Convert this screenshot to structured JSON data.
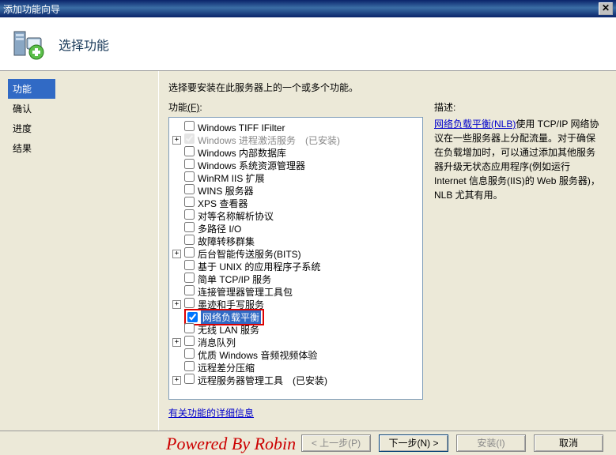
{
  "window": {
    "title": "添加功能向导"
  },
  "header": {
    "title": "选择功能"
  },
  "sidebar": {
    "items": [
      {
        "label": "功能",
        "active": true
      },
      {
        "label": "确认",
        "active": false
      },
      {
        "label": "进度",
        "active": false
      },
      {
        "label": "结果",
        "active": false
      }
    ]
  },
  "content": {
    "instruction": "选择要安装在此服务器上的一个或多个功能。",
    "feature_label_prefix": "功能",
    "feature_label_key": "(F)",
    "feature_label_suffix": ":",
    "more_link": "有关功能的详细信息"
  },
  "tree": [
    {
      "label": "Windows TIFF IFilter",
      "expand": "",
      "checked": false,
      "disabled": false
    },
    {
      "label": "Windows 进程激活服务　(已安装)",
      "expand": "+",
      "checked": true,
      "disabled": true
    },
    {
      "label": "Windows 内部数据库",
      "expand": "",
      "checked": false,
      "disabled": false
    },
    {
      "label": "Windows 系统资源管理器",
      "expand": "",
      "checked": false,
      "disabled": false
    },
    {
      "label": "WinRM IIS 扩展",
      "expand": "",
      "checked": false,
      "disabled": false
    },
    {
      "label": "WINS 服务器",
      "expand": "",
      "checked": false,
      "disabled": false
    },
    {
      "label": "XPS 查看器",
      "expand": "",
      "checked": false,
      "disabled": false
    },
    {
      "label": "对等名称解析协议",
      "expand": "",
      "checked": false,
      "disabled": false
    },
    {
      "label": "多路径 I/O",
      "expand": "",
      "checked": false,
      "disabled": false
    },
    {
      "label": "故障转移群集",
      "expand": "",
      "checked": false,
      "disabled": false
    },
    {
      "label": "后台智能传送服务(BITS)",
      "expand": "+",
      "checked": false,
      "disabled": false
    },
    {
      "label": "基于 UNIX 的应用程序子系统",
      "expand": "",
      "checked": false,
      "disabled": false
    },
    {
      "label": "简单 TCP/IP 服务",
      "expand": "",
      "checked": false,
      "disabled": false
    },
    {
      "label": "连接管理器管理工具包",
      "expand": "",
      "checked": false,
      "disabled": false
    },
    {
      "label": "墨迹和手写服务",
      "expand": "+",
      "checked": false,
      "disabled": false
    },
    {
      "label": "网络负载平衡",
      "expand": "",
      "checked": true,
      "disabled": false,
      "highlight": true
    },
    {
      "label": "无线 LAN 服务",
      "expand": "",
      "checked": false,
      "disabled": false
    },
    {
      "label": "消息队列",
      "expand": "+",
      "checked": false,
      "disabled": false
    },
    {
      "label": "优质 Windows 音频视频体验",
      "expand": "",
      "checked": false,
      "disabled": false
    },
    {
      "label": "远程差分压缩",
      "expand": "",
      "checked": false,
      "disabled": false
    },
    {
      "label": "远程服务器管理工具　(已安装)",
      "expand": "+",
      "checked": false,
      "disabled": false
    }
  ],
  "description": {
    "title": "描述:",
    "link_text": "网络负载平衡(NLB)",
    "body": "使用 TCP/IP 网络协议在一些服务器上分配流量。对于确保在负载增加时，可以通过添加其他服务器升级无状态应用程序(例如运行 Internet 信息服务(IIS)的 Web 服务器)，NLB 尤其有用。"
  },
  "buttons": {
    "prev": "< 上一步(P)",
    "next": "下一步(N) >",
    "install": "安装(I)",
    "cancel": "取消"
  },
  "watermark": "Powered By Robin"
}
